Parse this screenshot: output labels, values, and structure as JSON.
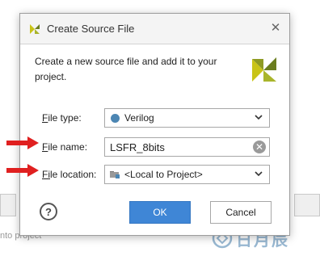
{
  "dialog": {
    "title": "Create Source File",
    "intro": "Create a new source file and add it to your project.",
    "fields": {
      "file_type": {
        "label_prefix": "F",
        "label_rest": "ile type:",
        "value": "Verilog"
      },
      "file_name": {
        "label_prefix": "F",
        "label_rest": "ile name:",
        "value": "LSFR_8bits"
      },
      "file_location": {
        "label_prefix": "Fi",
        "label_rest": "le location:",
        "value": "<Local to Project>"
      }
    },
    "buttons": {
      "help": "?",
      "ok": "OK",
      "cancel": "Cancel"
    }
  },
  "background": {
    "partial_text": "nto project"
  },
  "watermark": {
    "text": "日月辰"
  },
  "colors": {
    "accent_blue": "#3f86d6",
    "verilog_dot": "#4c86b3",
    "annotation_arrow": "#e02020",
    "logo_yellow": "#c9c417",
    "logo_green": "#6b7d1f"
  }
}
